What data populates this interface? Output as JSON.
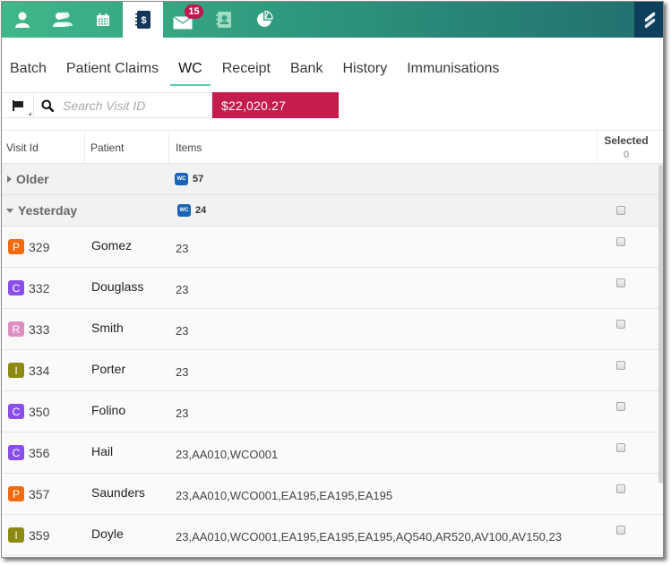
{
  "nav": {
    "icons": [
      {
        "name": "user-icon",
        "label": "Patient"
      },
      {
        "name": "users-icon",
        "label": "Patients"
      },
      {
        "name": "calendar-icon",
        "label": "Calendar"
      },
      {
        "name": "billing-icon",
        "label": "Billing",
        "active": true
      },
      {
        "name": "mail-icon",
        "label": "Messages",
        "badge": "15"
      },
      {
        "name": "contacts-icon",
        "label": "Contacts"
      },
      {
        "name": "reports-icon",
        "label": "Reports"
      }
    ],
    "mail_badge": "15"
  },
  "tabs": [
    {
      "label": "Batch"
    },
    {
      "label": "Patient Claims"
    },
    {
      "label": "WC",
      "active": true
    },
    {
      "label": "Receipt"
    },
    {
      "label": "Bank"
    },
    {
      "label": "History"
    },
    {
      "label": "Immunisations"
    }
  ],
  "toolbar": {
    "search_placeholder": "Search Visit ID",
    "search_value": "",
    "total": "$22,020.27"
  },
  "table": {
    "headers": {
      "visit_id": "Visit Id",
      "patient": "Patient",
      "items": "Items",
      "selected": "Selected",
      "selected_count": "0"
    },
    "groups": [
      {
        "name": "Older",
        "expanded": false,
        "badge": "WC",
        "count": "57"
      },
      {
        "name": "Yesterday",
        "expanded": true,
        "badge": "WC",
        "count": "24"
      }
    ],
    "rows": [
      {
        "type": "P",
        "type_color": "#f26a10",
        "visit_id": "329",
        "patient": "Gomez",
        "items": "23"
      },
      {
        "type": "C",
        "type_color": "#8a4ee8",
        "visit_id": "332",
        "patient": "Douglass",
        "items": "23"
      },
      {
        "type": "R",
        "type_color": "#e08ec2",
        "visit_id": "333",
        "patient": "Smith",
        "items": "23"
      },
      {
        "type": "I",
        "type_color": "#8c8a12",
        "visit_id": "334",
        "patient": "Porter",
        "items": "23"
      },
      {
        "type": "C",
        "type_color": "#8a4ee8",
        "visit_id": "350",
        "patient": "Folino",
        "items": "23"
      },
      {
        "type": "C",
        "type_color": "#8a4ee8",
        "visit_id": "356",
        "patient": "Hail",
        "items": "23,AA010,WCO001"
      },
      {
        "type": "P",
        "type_color": "#f26a10",
        "visit_id": "357",
        "patient": "Saunders",
        "items": "23,AA010,WCO001,EA195,EA195,EA195"
      },
      {
        "type": "I",
        "type_color": "#8c8a12",
        "visit_id": "359",
        "patient": "Doyle",
        "items": "23,AA010,WCO001,EA195,EA195,EA195,AQ540,AR520,AV100,AV150,23"
      }
    ]
  },
  "colors": {
    "accent": "#5fcba4",
    "total_bg": "#c41c4d",
    "brand_bg": "#0e3f5c",
    "wc_badge": "#1a64b8"
  }
}
